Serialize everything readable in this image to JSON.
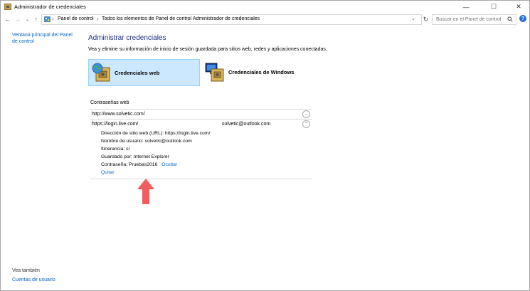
{
  "window": {
    "title": "Administrador de credenciales",
    "minimize": "—",
    "maximize": "☐",
    "close": "✕",
    "help": "?"
  },
  "address": {
    "crumbs": [
      "Panel de control",
      "Todos los elementos de Panel de control",
      "Administrador de credenciales"
    ],
    "search_placeholder": "Buscar en el Panel de control"
  },
  "sidebar": {
    "home_link": "Ventana principal del Panel de control",
    "see_also": "Vea también",
    "user_accounts": "Cuentas de usuario"
  },
  "main": {
    "heading": "Administrar credenciales",
    "description": "Vea y elimine su información de inicio de sesión guardada para sitios web, redes y aplicaciones conectadas.",
    "tabs": [
      {
        "label": "Credenciales web",
        "selected": true
      },
      {
        "label": "Credenciales de Windows",
        "selected": false
      }
    ],
    "section_title": "Contraseñas web",
    "entries": [
      {
        "url": "http://www.solvetic.com/",
        "user": "",
        "expanded": false
      },
      {
        "url": "https://login.live.com/",
        "user": "solvetic@outlook.com",
        "expanded": true
      }
    ],
    "details": {
      "url_label": "Dirección de sitio web (URL):",
      "url_value": "https://login.live.com/",
      "user_label": "Nombre de usuario:",
      "user_value": "solvetic@outlook.com",
      "roaming_label": "Itinerancia:",
      "roaming_value": "sí",
      "saved_by_label": "Guardado por:",
      "saved_by_value": "Internet Explorer",
      "password_label": "Contraseña:",
      "password_value": "Pruebas2016",
      "hide_link": "Ocultar",
      "remove_link": "Quitar"
    }
  },
  "colors": {
    "heading": "#1e3287",
    "link": "#0066cc",
    "tile_selected": "#cce8ff",
    "arrow": "#f25c5c"
  }
}
